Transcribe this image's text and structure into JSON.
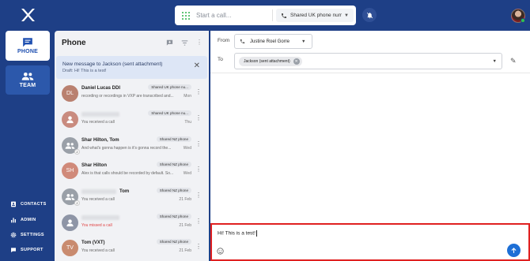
{
  "topbar": {
    "call_placeholder": "Start a call...",
    "line_select": "Shared UK phone num...",
    "accent": "#2cb34a"
  },
  "nav": {
    "primary": [
      {
        "label": "PHONE",
        "icon": "chat-icon",
        "active": true
      },
      {
        "label": "TEAM",
        "icon": "people-icon",
        "active": false
      }
    ],
    "bottom": [
      {
        "label": "CONTACTS",
        "icon": "contacts-icon"
      },
      {
        "label": "ADMIN",
        "icon": "bar-chart-icon"
      },
      {
        "label": "SETTINGS",
        "icon": "gear-icon"
      },
      {
        "label": "SUPPORT",
        "icon": "support-icon"
      }
    ]
  },
  "phone_panel": {
    "title": "Phone",
    "notice": {
      "title": "New message to Jackson (sent attachment)",
      "subtitle": "Draft: Hi! This is a test!"
    },
    "rows": [
      {
        "initials": "DL",
        "name": "Daniel Lucas DDI",
        "snippet": "recording or recordings in VXP are transcribed and...",
        "badge": "Shared UK phone nu...",
        "date": "Mon",
        "avatar_color": "#b9806f",
        "type": "initials"
      },
      {
        "initials": "",
        "name": "",
        "snippet": "You received a call",
        "badge": "Shared UK phone nu...",
        "date": "Thu",
        "avatar_color": "#c98b7f",
        "type": "person"
      },
      {
        "initials": "",
        "name": "Shar Hilton, Tom",
        "snippet": "And what's gonna happen is it's gonna record the...",
        "badge": "Shared NZ phone",
        "date": "Wed",
        "avatar_color": "#9aa0a8",
        "type": "group",
        "count": "2"
      },
      {
        "initials": "SH",
        "name": "Shar Hilton",
        "snippet": "Alex is that calls should be recorded by default. So...",
        "badge": "Shared NZ phone",
        "date": "Wed",
        "avatar_color": "#d08a7a",
        "type": "initials"
      },
      {
        "initials": "",
        "name": "Tom",
        "snippet": "You received a call",
        "badge": "Shared NZ phone",
        "date": "21 Feb",
        "avatar_color": "#9aa0a8",
        "type": "group",
        "count": "2"
      },
      {
        "initials": "",
        "name": "",
        "snippet": "You missed a call",
        "badge": "Shared NZ phone",
        "date": "21 Feb",
        "avatar_color": "#8e95a6",
        "type": "person",
        "missed": true
      },
      {
        "initials": "TV",
        "name": "Tom (VXT)",
        "snippet": "You received a call",
        "badge": "Shared NZ phone",
        "date": "21 Feb",
        "avatar_color": "#c98b6f",
        "type": "initials"
      }
    ]
  },
  "compose": {
    "from_label": "From",
    "from_value": "Justine Roel Gorre",
    "to_label": "To",
    "to_chip": "Jackson (sent attachment)",
    "message": "Hi! This is a test!",
    "highlight_color": "#e02020",
    "send_color": "#1d6fd6"
  }
}
